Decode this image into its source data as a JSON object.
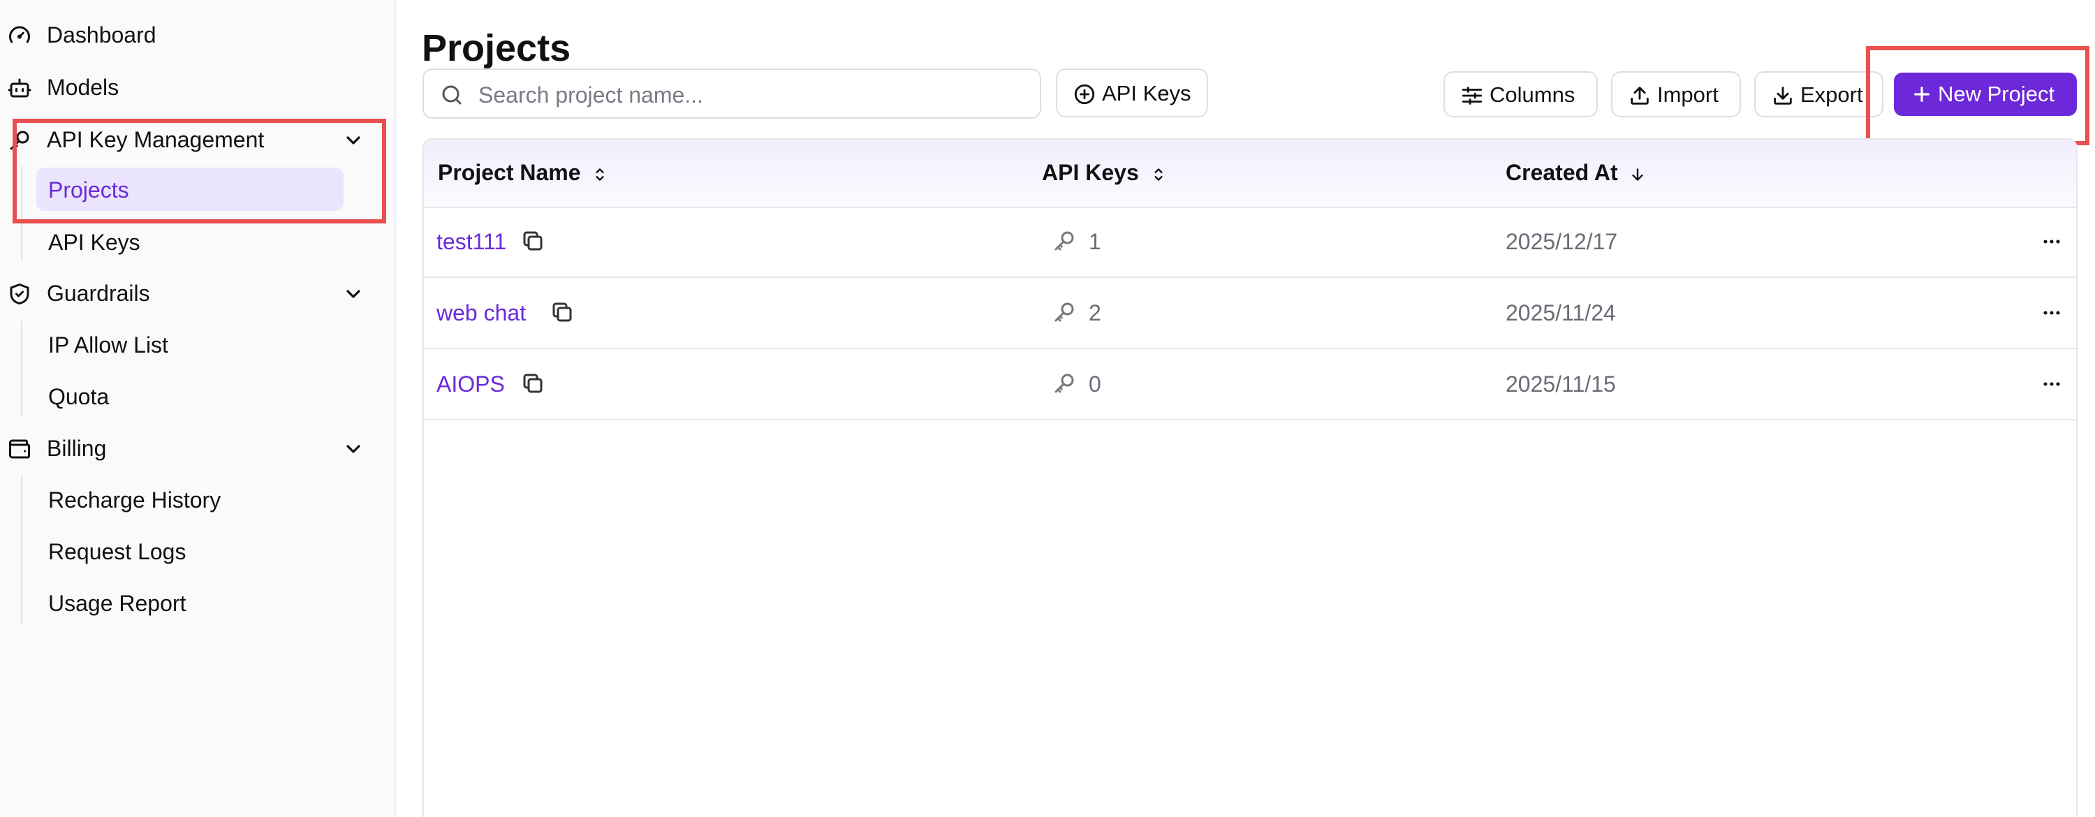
{
  "sidebar": {
    "items": [
      {
        "label": "Dashboard",
        "icon": "gauge-icon"
      },
      {
        "label": "Models",
        "icon": "robot-icon"
      },
      {
        "label": "API Key Management",
        "icon": "key-icon",
        "children": [
          "Projects",
          "API Keys"
        ],
        "active_child": "Projects"
      },
      {
        "label": "Guardrails",
        "icon": "shield-check-icon",
        "children": [
          "IP Allow List",
          "Quota"
        ]
      },
      {
        "label": "Billing",
        "icon": "wallet-icon",
        "children": [
          "Recharge History",
          "Request Logs",
          "Usage Report"
        ]
      }
    ]
  },
  "main": {
    "title": "Projects",
    "search": {
      "placeholder": "Search project name...",
      "value": ""
    },
    "toolbar": {
      "api_keys_label": "API Keys",
      "columns_label": "Columns",
      "import_label": "Import",
      "export_label": "Export",
      "new_project_label": "New Project"
    },
    "table": {
      "headers": [
        "Project Name",
        "API Keys",
        "Created At"
      ],
      "rows": [
        {
          "name": "test111",
          "api_keys": "1",
          "created_at": "2025/12/17"
        },
        {
          "name": "web chat",
          "api_keys": "2",
          "created_at": "2025/11/24"
        },
        {
          "name": "AIOPS",
          "api_keys": "0",
          "created_at": "2025/11/15"
        }
      ]
    }
  },
  "colors": {
    "accent": "#6d28d9",
    "accent_text": "#6b2bd9",
    "active_bg": "#ebe4fd",
    "highlight": "#e9504f"
  }
}
